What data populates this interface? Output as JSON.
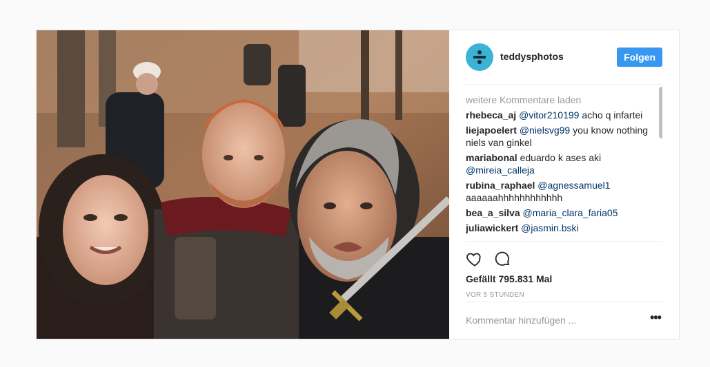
{
  "post": {
    "username": "teddysphotos",
    "follow_label": "Folgen",
    "avatar_icon": "divide-logo-icon",
    "load_more": "weitere Kommentare laden",
    "comments": [
      {
        "user": "rhebeca_aj",
        "mention": "@vitor210199",
        "text": " acho q infartei"
      },
      {
        "user": "liejapoelert",
        "mention": "@nielsvg99",
        "text": " you know nothing niels van ginkel"
      },
      {
        "user": "mariabonal",
        "text": " eduardo k ases aki ",
        "mention": "@mireia_calleja"
      },
      {
        "user": "rubina_raphael",
        "mention": "@agnessamuel1",
        "text": " aaaaaahhhhhhhhhhhh"
      },
      {
        "user": "bea_a_silva",
        "mention": "@maria_clara_faria05",
        "text": ""
      },
      {
        "user": "juliawickert",
        "mention": "@jasmin.bski",
        "text": ""
      }
    ],
    "likes": "Gefällt 795.831 Mal",
    "time": "VOR 5 STUNDEN",
    "comment_placeholder": "Kommentar hinzufügen ...",
    "more_icon": "ellipsis-icon",
    "colors": {
      "accent": "#3897f0",
      "mention": "#003569",
      "muted": "#999999"
    }
  }
}
